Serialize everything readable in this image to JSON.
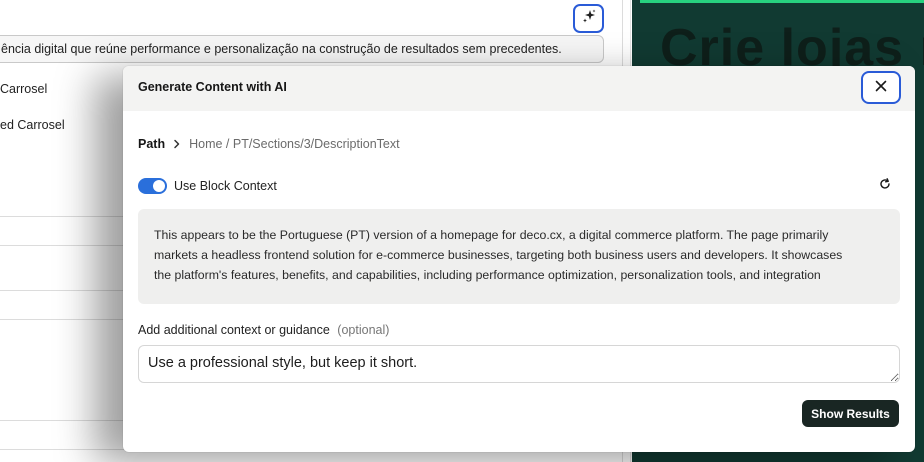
{
  "background": {
    "description_value": "ência digital que reúne performance e personalização na construção de resultados sem precedentes.",
    "sidebar_items": [
      "Carrosel",
      "ed Carrosel"
    ],
    "preview_headline": "Crie lojas r",
    "colors": {
      "preview_bg": "#113a32",
      "preview_accent": "#27d17f"
    }
  },
  "modal": {
    "title": "Generate Content with AI",
    "close_icon": "close-icon",
    "path": {
      "label": "Path",
      "value": "Home / PT/Sections/3/DescriptionText"
    },
    "block_context": {
      "label": "Use Block Context",
      "enabled": true,
      "lines": [
        "This appears to be the Portuguese (PT) version of a homepage for deco.cx, a digital commerce platform. The page primarily",
        "markets a headless frontend solution for e-commerce businesses, targeting both business users and developers. It showcases",
        "the platform's features, benefits, and capabilities, including performance optimization, personalization tools, and integration"
      ]
    },
    "guidance": {
      "label": "Add additional context or guidance",
      "optional": "(optional)",
      "value": "Use a professional style, but keep it short."
    },
    "show_results_label": "Show Results"
  },
  "colors": {
    "accent": "#2a5bd7",
    "toggle": "#2a6fdb",
    "primary_button": "#192623"
  }
}
